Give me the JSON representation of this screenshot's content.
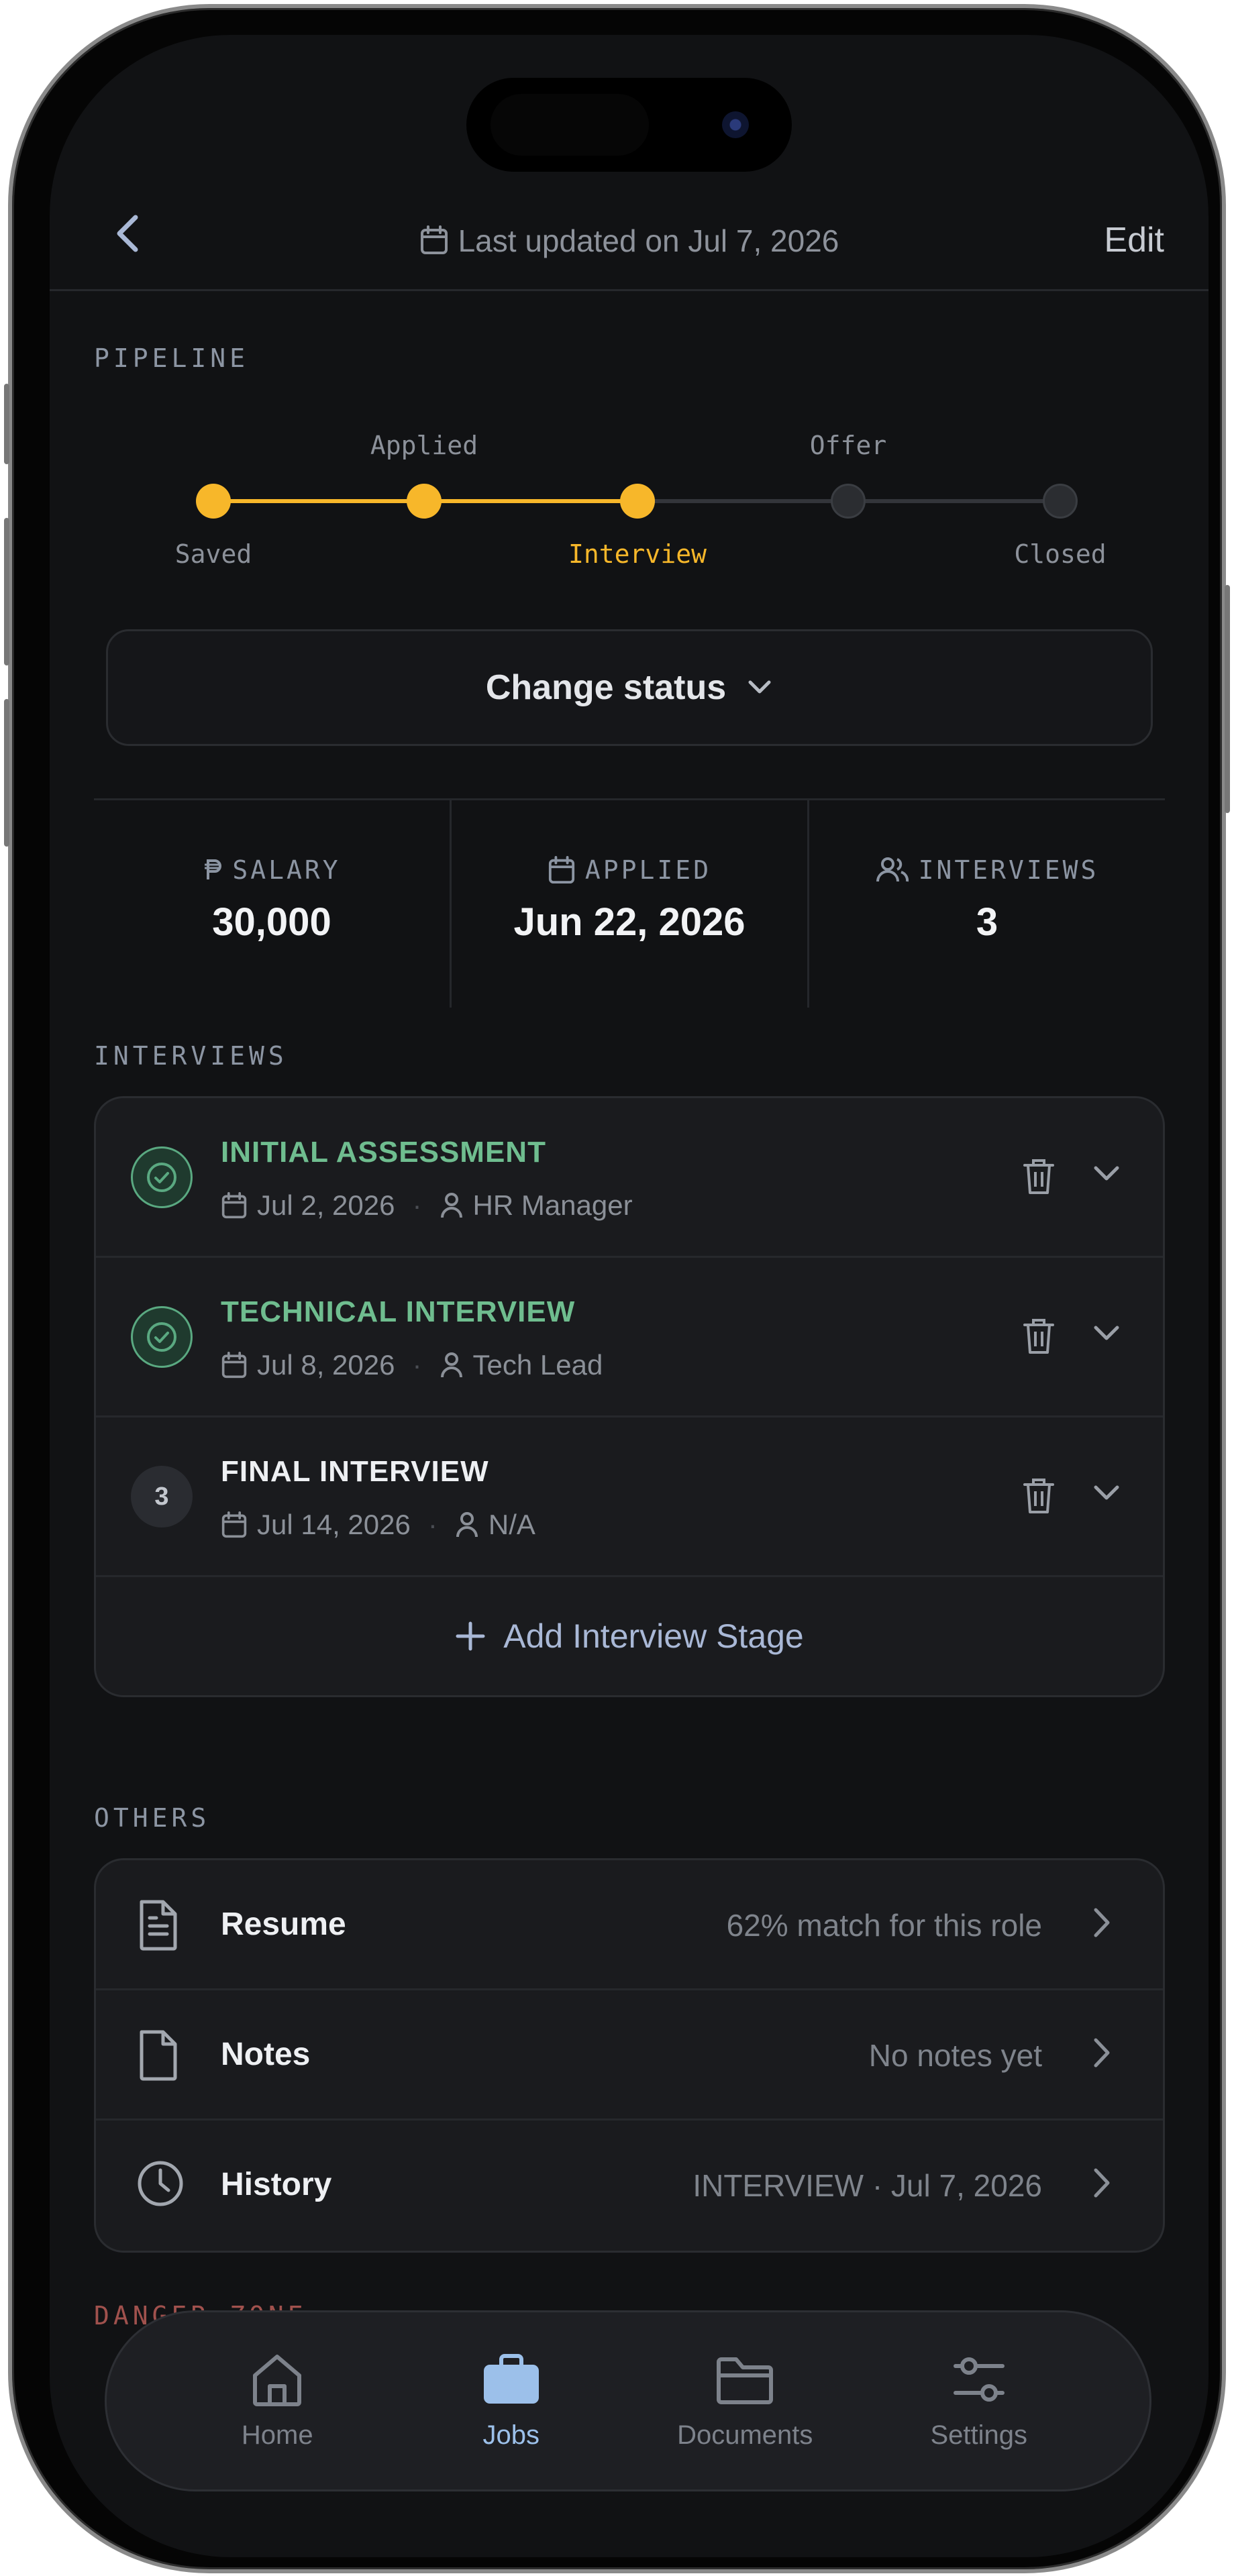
{
  "header": {
    "updated_text": "Last updated on Jul 7, 2026",
    "edit_label": "Edit"
  },
  "pipeline": {
    "section_label": "PIPELINE",
    "stages": [
      {
        "label": "Saved",
        "reached": true
      },
      {
        "label": "Applied",
        "reached": true
      },
      {
        "label": "Interview",
        "reached": true,
        "current": true
      },
      {
        "label": "Offer",
        "reached": false
      },
      {
        "label": "Closed",
        "reached": false
      }
    ],
    "change_status_label": "Change status"
  },
  "stats": {
    "salary": {
      "label": "SALARY",
      "value": "30,000"
    },
    "applied": {
      "label": "APPLIED",
      "value": "Jun 22, 2026"
    },
    "interviews": {
      "label": "INTERVIEWS",
      "value": "3"
    }
  },
  "interviews": {
    "section_label": "INTERVIEWS",
    "items": [
      {
        "title": "INITIAL ASSESSMENT",
        "date": "Jul 2, 2026",
        "person": "HR Manager",
        "status": "done"
      },
      {
        "title": "TECHNICAL INTERVIEW",
        "date": "Jul 8, 2026",
        "person": "Tech Lead",
        "status": "done"
      },
      {
        "title": "FINAL INTERVIEW",
        "date": "Jul 14, 2026",
        "person": "N/A",
        "status": "pending",
        "number": "3"
      }
    ],
    "add_label": "Add Interview Stage"
  },
  "others": {
    "section_label": "OTHERS",
    "items": [
      {
        "label": "Resume",
        "value": "62% match for this role",
        "icon": "document-text-icon"
      },
      {
        "label": "Notes",
        "value": "No notes yet",
        "icon": "file-icon"
      },
      {
        "label": "History",
        "value": "INTERVIEW · Jul 7, 2026",
        "icon": "clock-icon"
      }
    ]
  },
  "danger_label": "DANGER ZONE",
  "tabs": [
    {
      "label": "Home",
      "icon": "home-icon",
      "active": false
    },
    {
      "label": "Jobs",
      "icon": "briefcase-icon",
      "active": true
    },
    {
      "label": "Documents",
      "icon": "folder-icon",
      "active": false
    },
    {
      "label": "Settings",
      "icon": "sliders-icon",
      "active": false
    }
  ],
  "colors": {
    "accent": "#f7b72a",
    "done_green": "#6fbd8f",
    "tab_active": "#9cc0ea",
    "danger": "#a0514d",
    "background": "#111214"
  }
}
